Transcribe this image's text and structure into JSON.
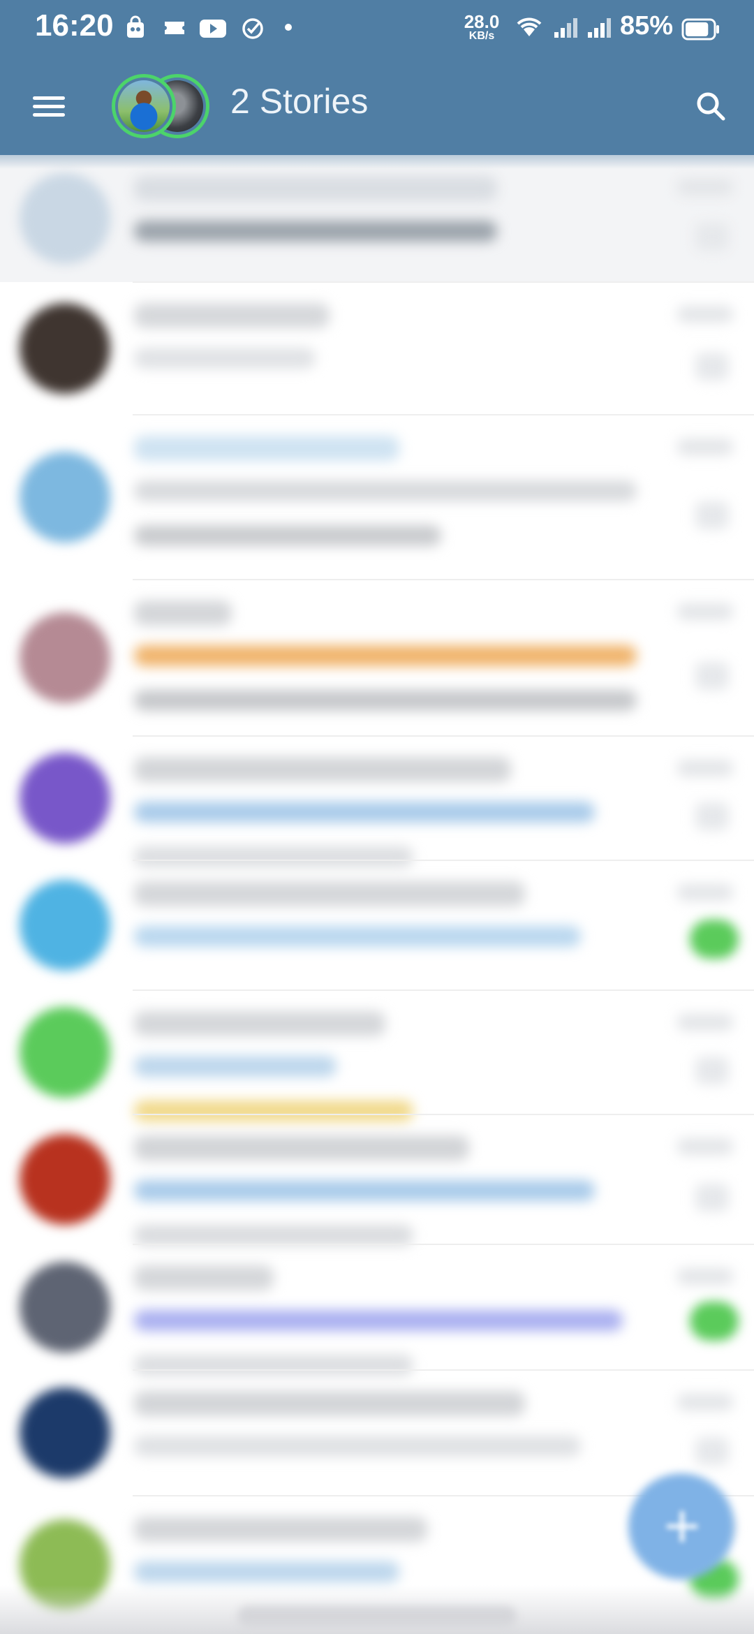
{
  "status_bar": {
    "time": "16:20",
    "notification_icons": [
      "shopping-bag-icon",
      "ticket-icon",
      "youtube-icon",
      "check-circle-icon",
      "dot-icon"
    ],
    "network_speed_value": "28.0",
    "network_speed_unit": "KB/s",
    "wifi_icon": "wifi-icon",
    "signal_icons": [
      "signal-icon",
      "signal-icon"
    ],
    "battery_percent": "85%",
    "battery_level": 0.85
  },
  "toolbar": {
    "menu_icon": "hamburger-menu-icon",
    "stories_title": "2 Stories",
    "search_icon": "search-icon"
  },
  "colors": {
    "header": "#507ea4",
    "story_ring": "#4cd46a",
    "unread_badge": "#5bcb5b",
    "fab": "#7fb2e6"
  },
  "chat_list": {
    "note": "",
    "rows": [
      {
        "kind": "archived",
        "avatar_color": "#c9d7e4",
        "preview_colors": [
          "#d9dde2",
          "#9ba3ab"
        ],
        "badge": false
      },
      {
        "kind": "chat",
        "avatar_color": "#3f3530",
        "preview_colors": [
          "#d6d8db",
          "#e0e2e5"
        ],
        "badge": false
      },
      {
        "kind": "chat",
        "avatar_color": "#7db8e0",
        "preview_colors": [
          "#cfe3f2",
          "#d8dadd",
          "#c9cbce"
        ],
        "badge": false
      },
      {
        "kind": "chat",
        "avatar_color": "#b58a94",
        "preview_colors": [
          "#d4d6d9",
          "#f0b36a",
          "#c6c8cb"
        ],
        "badge": false
      },
      {
        "kind": "chat",
        "avatar_color": "#7857c9",
        "preview_colors": [
          "#d3d5d8",
          "#a9cbea",
          "#dcdee1"
        ],
        "badge": false
      },
      {
        "kind": "chat",
        "avatar_color": "#4fb3e3",
        "preview_colors": [
          "#d5d7da",
          "#b9d7ef"
        ],
        "badge": true
      },
      {
        "kind": "chat",
        "avatar_color": "#5bcb5b",
        "preview_colors": [
          "#d5d7da",
          "#bcd6ec",
          "#f1d98a"
        ],
        "badge": false
      },
      {
        "kind": "chat",
        "avatar_color": "#b8321f",
        "preview_colors": [
          "#d2d4d7",
          "#a9cbea",
          "#dadcdf"
        ],
        "badge": false
      },
      {
        "kind": "chat",
        "avatar_color": "#5e6473",
        "preview_colors": [
          "#d5d7da",
          "#aab0f0",
          "#dcdee1"
        ],
        "badge": true
      },
      {
        "kind": "chat",
        "avatar_color": "#1c3a6a",
        "preview_colors": [
          "#d3d5d8",
          "#dfe1e4"
        ],
        "badge": false
      },
      {
        "kind": "chat",
        "avatar_color": "#8dbb55",
        "preview_colors": [
          "#d4d6d9",
          "#bcd6ec"
        ],
        "badge": true
      }
    ]
  },
  "fab": {
    "icon": "pencil-icon"
  }
}
